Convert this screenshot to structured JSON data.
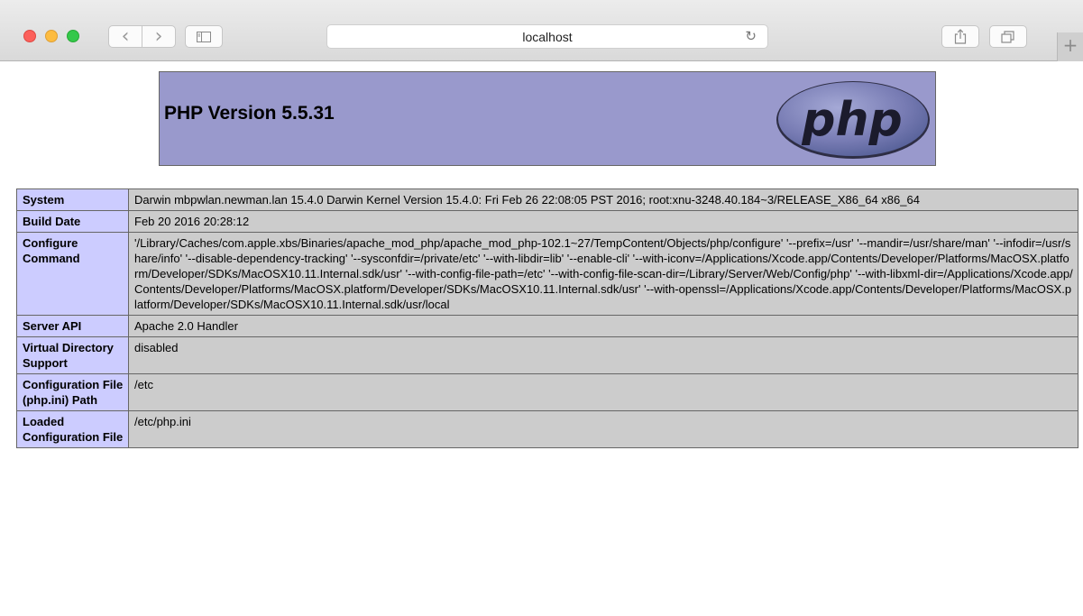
{
  "browser": {
    "url_text": "localhost",
    "traffic_lights": [
      "close-button",
      "minimize-button",
      "zoom-button"
    ],
    "icons": {
      "back": "chevron-left-icon",
      "forward": "chevron-right-icon",
      "sidebar": "sidebar-icon",
      "reload": "reload-icon",
      "share": "share-icon",
      "tabs": "tab-overview-icon",
      "new_tab": "plus-icon"
    },
    "glyphs": {
      "back": "‹",
      "forward": "›",
      "reload": "↻",
      "new_tab": "+"
    }
  },
  "page": {
    "heading": "PHP Version 5.5.31",
    "logo_text": "php",
    "colors": {
      "header_bg": "#9999cc",
      "key_bg": "#ccccff",
      "value_bg": "#cccccc",
      "border": "#666666"
    },
    "rows": [
      {
        "key": "System",
        "value": "Darwin mbpwlan.newman.lan 15.4.0 Darwin Kernel Version 15.4.0: Fri Feb 26 22:08:05 PST 2016; root:xnu-3248.40.184~3/RELEASE_X86_64 x86_64"
      },
      {
        "key": "Build Date",
        "value": "Feb 20 2016 20:28:12"
      },
      {
        "key": "Configure Command",
        "value": "'/Library/Caches/com.apple.xbs/Binaries/apache_mod_php/apache_mod_php-102.1~27/TempContent/Objects/php/configure' '--prefix=/usr' '--mandir=/usr/share/man' '--infodir=/usr/share/info' '--disable-dependency-tracking' '--sysconfdir=/private/etc' '--with-libdir=lib' '--enable-cli' '--with-iconv=/Applications/Xcode.app/Contents/Developer/Platforms/MacOSX.platform/Developer/SDKs/MacOSX10.11.Internal.sdk/usr' '--with-config-file-path=/etc' '--with-config-file-scan-dir=/Library/Server/Web/Config/php' '--with-libxml-dir=/Applications/Xcode.app/Contents/Developer/Platforms/MacOSX.platform/Developer/SDKs/MacOSX10.11.Internal.sdk/usr' '--with-openssl=/Applications/Xcode.app/Contents/Developer/Platforms/MacOSX.platform/Developer/SDKs/MacOSX10.11.Internal.sdk/usr/local"
      },
      {
        "key": "Server API",
        "value": "Apache 2.0 Handler"
      },
      {
        "key": "Virtual Directory Support",
        "value": "disabled"
      },
      {
        "key": "Configuration File (php.ini) Path",
        "value": "/etc"
      },
      {
        "key": "Loaded Configuration File",
        "value": "/etc/php.ini"
      }
    ]
  }
}
